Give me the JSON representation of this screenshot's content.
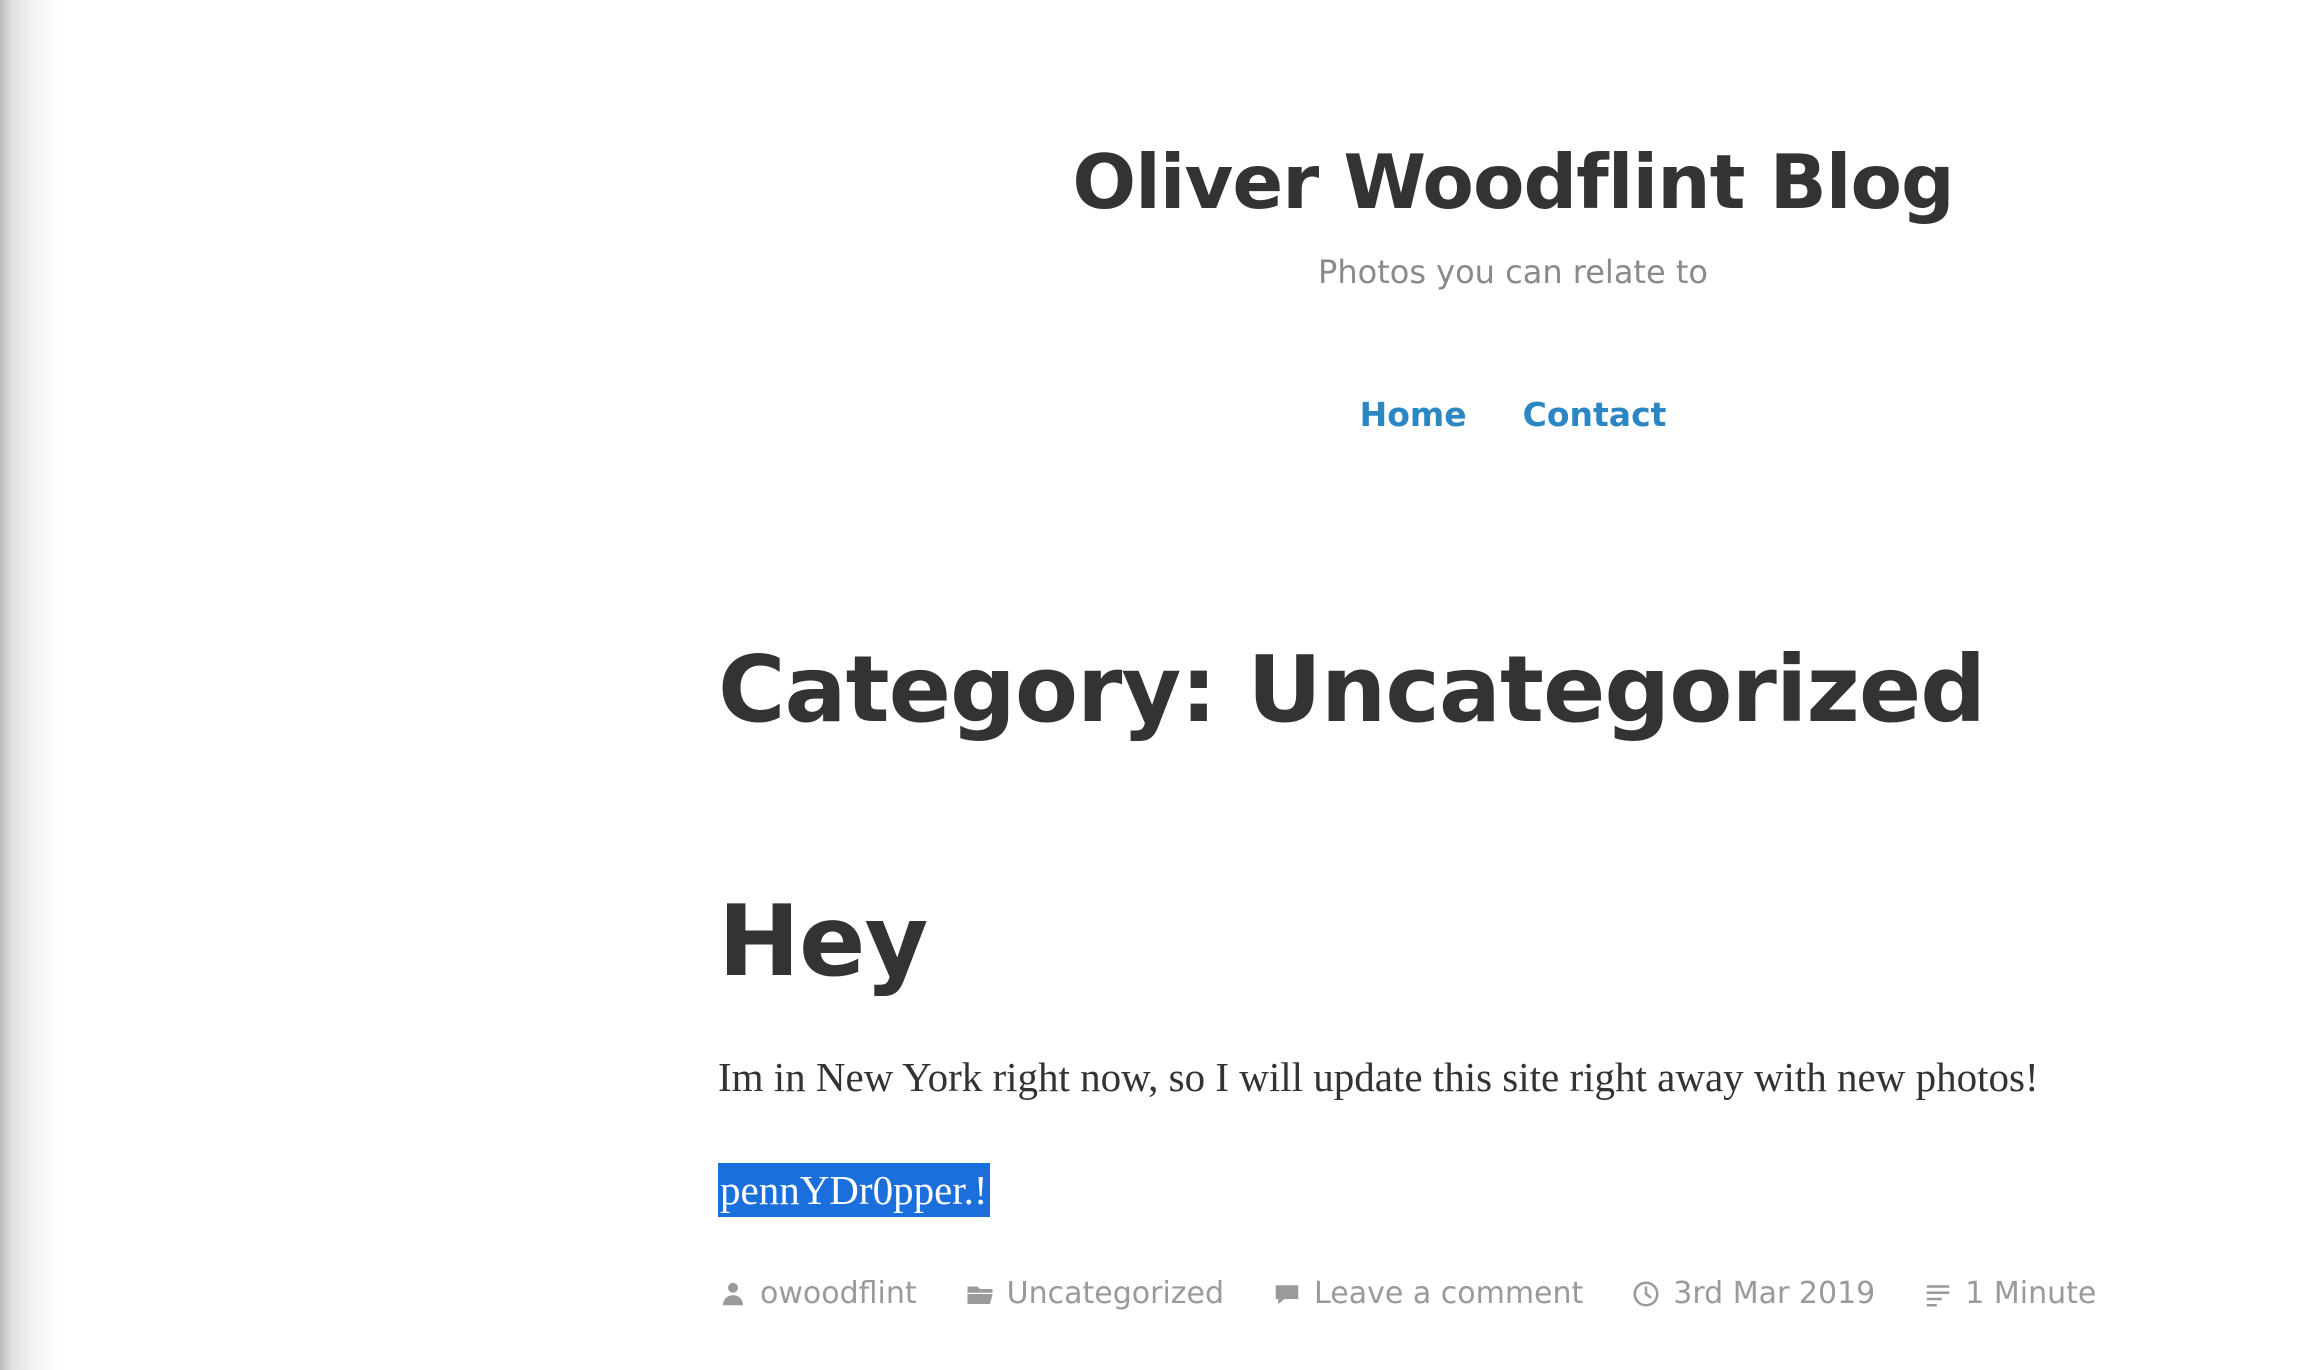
{
  "site": {
    "title": "Oliver Woodflint Blog",
    "description": "Photos you can relate to"
  },
  "nav": {
    "items": [
      {
        "label": "Home"
      },
      {
        "label": "Contact"
      }
    ]
  },
  "archive": {
    "title": "Category: Uncategorized"
  },
  "post": {
    "title": "Hey",
    "content": "Im in New York right now, so I will update this site right away with new photos!",
    "selected_text": "pennYDr0pper.!",
    "meta": {
      "author": "owoodflint",
      "category": "Uncategorized",
      "comments": "Leave a comment",
      "date": "3rd Mar 2019",
      "reading_time": "1 Minute"
    }
  },
  "colors": {
    "link": "#2b86c4",
    "text": "#333333",
    "muted": "#9a9a9a",
    "selection": "#1a6fdc"
  },
  "icons": {
    "author": "person-icon",
    "category": "folder-icon",
    "comments": "comment-bubble-icon",
    "date": "clock-icon",
    "reading_time": "reading-time-icon"
  }
}
